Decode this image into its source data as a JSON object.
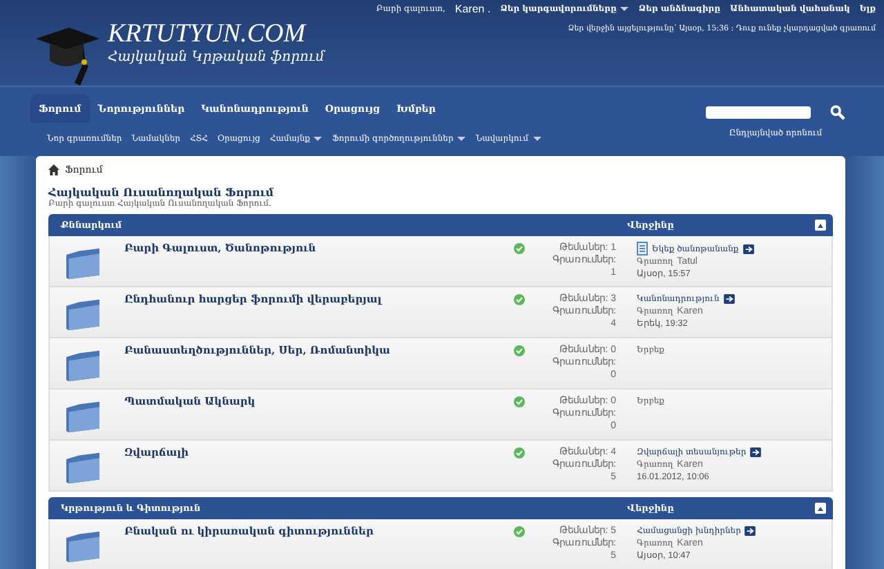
{
  "site": {
    "name": "KRTUTYUN.COM",
    "tagline": "Հայկական Կրթական ֆորում"
  },
  "top_links": [
    {
      "label": "Բարի գալուստ,",
      "kind": "text"
    },
    {
      "label": "Karen .",
      "kind": "user"
    },
    {
      "label": "Ձեր կարգավորումները",
      "kind": "menu"
    },
    {
      "label": "Ձեր անձնագիրը",
      "kind": "link"
    },
    {
      "label": "Անհատական վահանակ",
      "kind": "link"
    },
    {
      "label": "Ելք",
      "kind": "link"
    }
  ],
  "last_visit": "Ձեր վերջին այցելությունը՝ Այսօր, 15:36 : Դուք ունեք չկարդացված գրառում",
  "tabs": [
    {
      "label": "Ֆորում",
      "selected": true
    },
    {
      "label": "Նորություններ",
      "selected": false
    },
    {
      "label": "Կանոնադրություն",
      "selected": false
    },
    {
      "label": "Օրացույց",
      "selected": false
    },
    {
      "label": "Խմբեր",
      "selected": false
    }
  ],
  "subnav": [
    {
      "label": "Նոր գրառումներ",
      "has_menu": false
    },
    {
      "label": "Նամակներ",
      "has_menu": false
    },
    {
      "label": "ՀՏՀ",
      "has_menu": false
    },
    {
      "label": "Օրացույց",
      "has_menu": false
    },
    {
      "label": "Համայնք",
      "has_menu": true
    },
    {
      "label": "Ֆորումի գործողություններ",
      "has_menu": true
    },
    {
      "label": "Նավարկում",
      "has_menu": true
    }
  ],
  "search": {
    "advanced": "Ընդլայնված որոնում"
  },
  "breadcrumb": "Ֆորում",
  "forum_title": "Հայկական Ուսանողական Ֆորում",
  "forum_welcome": "Բարի գալուստ Հայկական Ուսանողական Ֆորում.",
  "sections": [
    {
      "title": "Քննարկում",
      "last_heading": "Վերջինը",
      "forums": [
        {
          "name": "Բարի Գալուստ, Ծանոթություն",
          "threads": "Թեմաներ: 1",
          "posts_label": "Գրառումներ:",
          "posts": "1",
          "last": {
            "title": "Եկեք ծանոթանանք",
            "by_label": "Գրառող",
            "by": "Tatul",
            "time": "Այսօր, 15:57"
          },
          "has_doc": true
        },
        {
          "name": "Ընդհանուր հարցեր ֆորումի վերաբերյալ",
          "threads": "Թեմաներ: 3",
          "posts_label": "Գրառումներ:",
          "posts": "4",
          "last": {
            "title": "Կանոնադրություն",
            "by_label": "Գրառող",
            "by": "Karen",
            "time": "Երեկ, 19:32"
          },
          "has_doc": false
        },
        {
          "name": "Բանաստեղծություններ, Սեր, Ռոմանտիկա",
          "threads": "Թեմաներ: 0",
          "posts_label": "Գրառումներ:",
          "posts": "0",
          "never": "Երբեք",
          "has_doc": false
        },
        {
          "name": "Պատմական Ակնարկ",
          "threads": "Թեմաներ: 0",
          "posts_label": "Գրառումներ:",
          "posts": "0",
          "never": "Երբեք",
          "has_doc": false
        },
        {
          "name": "Զվարճալի",
          "threads": "Թեմաներ: 4",
          "posts_label": "Գրառումներ:",
          "posts": "5",
          "last": {
            "title": "Զվարճալի տեսանյութեր",
            "by_label": "Գրառող",
            "by": "Karen",
            "time": "16.01.2012, 10:06"
          },
          "has_doc": false
        }
      ]
    },
    {
      "title": "Կրթություն և Գիտություն",
      "last_heading": "Վերջինը",
      "forums": [
        {
          "name": "Բնական ու կիրառական գիտություններ",
          "threads": "Թեմաներ: 5",
          "posts_label": "Գրառումներ:",
          "posts": "5",
          "last": {
            "title": "Համացանցի խնդիրներ",
            "by_label": "Գրառող",
            "by": "Karen",
            "time": "Այսօր, 10:47"
          },
          "has_doc": false
        }
      ]
    }
  ]
}
